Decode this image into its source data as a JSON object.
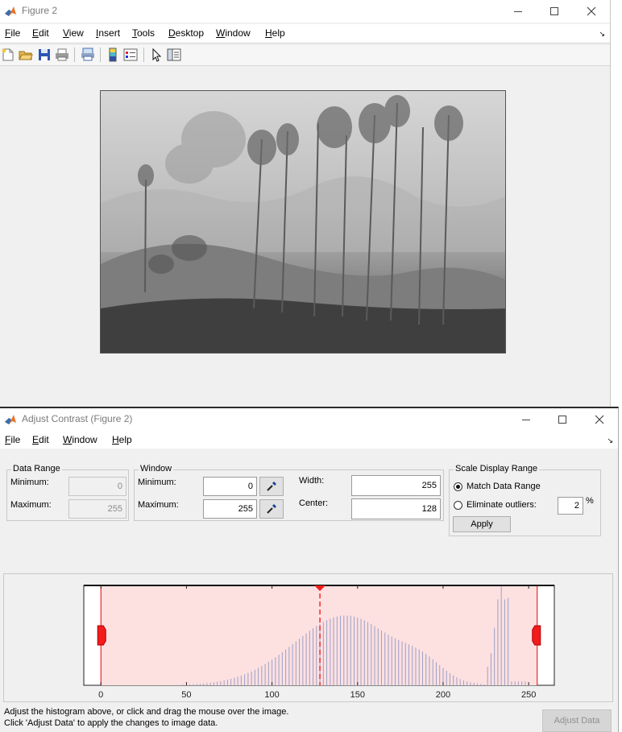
{
  "figure_window": {
    "title": "Figure 2",
    "menus": [
      "File",
      "Edit",
      "View",
      "Insert",
      "Tools",
      "Desktop",
      "Window",
      "Help"
    ],
    "menu_mnemonics": [
      "F",
      "E",
      "V",
      "I",
      "T",
      "D",
      "W",
      "H"
    ],
    "toolbar_icons": [
      "new-figure-icon",
      "open-file-icon",
      "save-icon",
      "print-icon",
      "print-preview-icon",
      "colorbar-icon",
      "legend-icon",
      "select-pointer-icon",
      "property-inspector-icon"
    ]
  },
  "adjust_window": {
    "title": "Adjust Contrast (Figure 2)",
    "menus": [
      "File",
      "Edit",
      "Window",
      "Help"
    ],
    "menu_mnemonics": [
      "F",
      "E",
      "W",
      "H"
    ],
    "data_range": {
      "label": "Data Range",
      "min_label": "Minimum:",
      "min_value": "0",
      "max_label": "Maximum:",
      "max_value": "255"
    },
    "window_group": {
      "label": "Window",
      "min_label": "Minimum:",
      "min_value": "0",
      "max_label": "Maximum:",
      "max_value": "255",
      "width_label": "Width:",
      "width_value": "255",
      "center_label": "Center:",
      "center_value": "128"
    },
    "scale_display": {
      "label": "Scale Display Range",
      "match_label": "Match Data Range",
      "outliers_label": "Eliminate outliers:",
      "outliers_value": "2",
      "percent": "%",
      "selected": "match",
      "apply_label": "Apply"
    },
    "histogram": {
      "x_ticks": [
        "0",
        "50",
        "100",
        "150",
        "200",
        "250"
      ],
      "xlim": [
        -10,
        265
      ],
      "window_min": 0,
      "window_max": 255,
      "center": 128
    },
    "hint_line1": "Adjust the histogram above, or click and drag the mouse over the image.",
    "hint_line2": "Click 'Adjust Data' to apply the changes to image data.",
    "adjust_data_label": "Adjust Data"
  },
  "colors": {
    "window_shade": "#fde0e0",
    "window_edge": "#e60000",
    "handle": "#f21c1c",
    "bars": "#9aa0c8",
    "title_inactive": "#7a7a7a"
  }
}
